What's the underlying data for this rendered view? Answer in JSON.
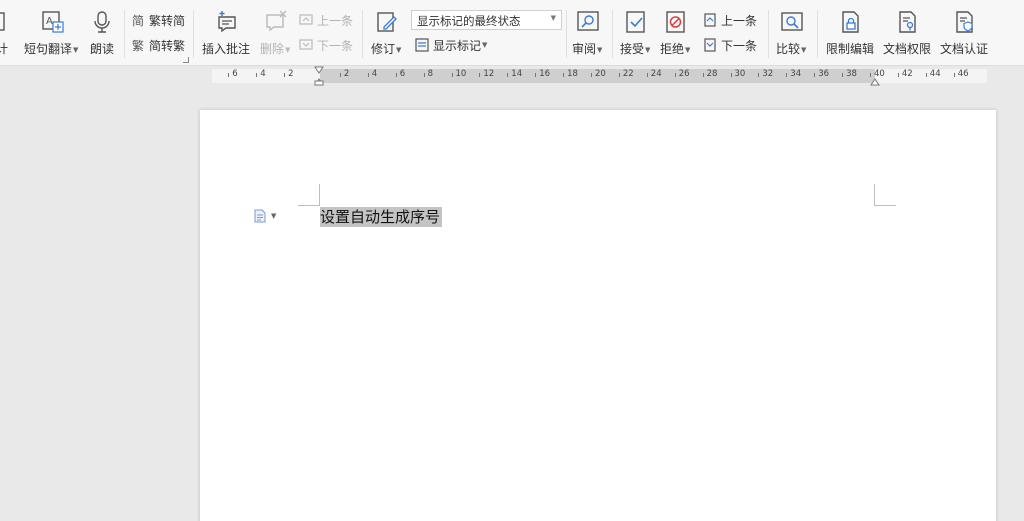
{
  "ribbon": {
    "partial_label": "计",
    "short_translate": "短句翻译",
    "read_aloud": "朗读",
    "trad_to_simp": "繁转简",
    "simp_to_trad": "简转繁",
    "insert_comment": "插入批注",
    "delete": "删除",
    "prev_comment": "上一条",
    "next_comment": "下一条",
    "track_changes": "修订",
    "markup_state": "显示标记的最终状态",
    "show_markup": "显示标记",
    "review": "审阅",
    "accept": "接受",
    "reject": "拒绝",
    "prev_change": "上一条",
    "next_change": "下一条",
    "compare": "比较",
    "restrict_editing": "限制编辑",
    "doc_permissions": "文档权限",
    "doc_certification": "文档认证"
  },
  "ruler": {
    "left_labels": [
      "6",
      "4",
      "2"
    ],
    "right_labels": [
      "2",
      "4",
      "6",
      "8",
      "10",
      "12",
      "14",
      "16",
      "18",
      "20",
      "22",
      "24",
      "26",
      "28",
      "30",
      "32",
      "34",
      "36",
      "38",
      "40",
      "42",
      "44",
      "46"
    ]
  },
  "document": {
    "selected_text": "设置自动生成序号"
  },
  "colors": {
    "ribbon_bg": "#f7f7f7",
    "selection": "#c4c4c4",
    "disabled_text": "#b3b3b3",
    "accent": "#3a7bd5"
  }
}
